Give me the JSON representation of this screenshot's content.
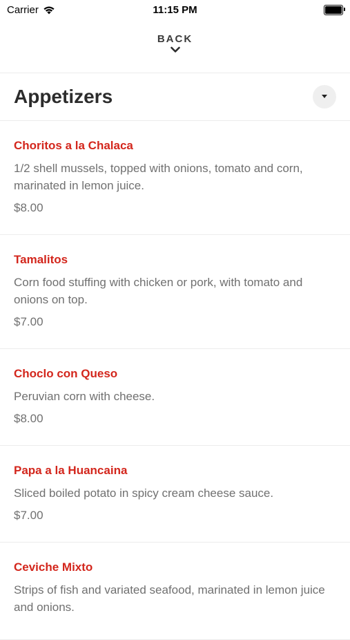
{
  "status": {
    "carrier": "Carrier",
    "time": "11:15 PM"
  },
  "nav": {
    "back_label": "BACK"
  },
  "section": {
    "title": "Appetizers"
  },
  "items": [
    {
      "name": "Choritos a la Chalaca",
      "description": "1/2 shell mussels, topped with onions, tomato and corn, marinated in lemon juice.",
      "price": "$8.00"
    },
    {
      "name": "Tamalitos",
      "description": "Corn food stuffing with chicken or pork, with tomato and onions on top.",
      "price": "$7.00"
    },
    {
      "name": "Choclo con Queso",
      "description": "Peruvian corn with cheese.",
      "price": "$8.00"
    },
    {
      "name": "Papa a la Huancaina",
      "description": "Sliced boiled potato in spicy cream cheese sauce.",
      "price": "$7.00"
    },
    {
      "name": "Ceviche Mixto",
      "description": "Strips of fish and variated seafood, marinated in lemon juice and onions.",
      "price": ""
    }
  ],
  "colors": {
    "item_name": "#d3261c",
    "text_muted": "#707070"
  }
}
